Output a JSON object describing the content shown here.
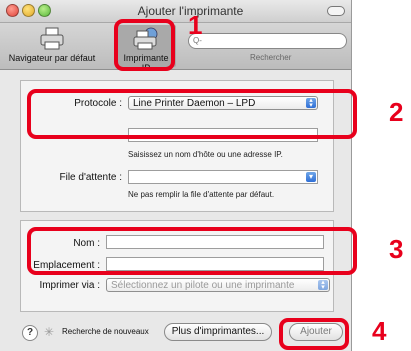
{
  "window": {
    "title": "Ajouter l'imprimante"
  },
  "toolbar": {
    "default_browser_label": "Navigateur par défaut",
    "ip_printer_label": "Imprimante IP",
    "search_placeholder": "Q-",
    "search_label": "Rechercher"
  },
  "form": {
    "protocol_label": "Protocole :",
    "protocol_value": "Line Printer Daemon – LPD",
    "address_hint": "Saisissez un nom d'hôte ou une adresse IP.",
    "queue_label": "File d'attente :",
    "queue_hint": "Ne pas remplir la file d'attente par défaut.",
    "name_label": "Nom :",
    "location_label": "Emplacement :",
    "print_using_label": "Imprimer via :",
    "print_using_value": "Sélectionnez un pilote ou une imprimante"
  },
  "footer": {
    "help": "?",
    "search_new": "Recherche de nouveaux",
    "more_printers": "Plus d'imprimantes...",
    "add": "Ajouter"
  },
  "annotations": {
    "step1": "1",
    "step2": "2",
    "step3": "3",
    "step4": "4",
    "color": "#e8001c"
  }
}
